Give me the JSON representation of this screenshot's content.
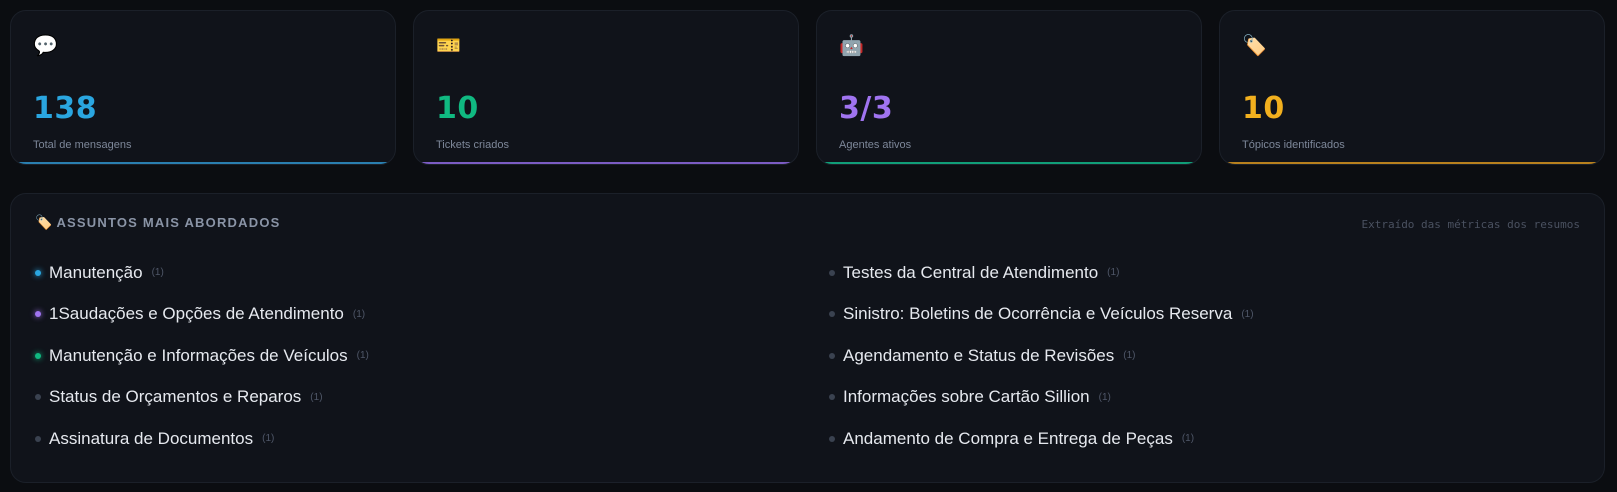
{
  "stats": [
    {
      "icon": "💬",
      "icon_name": "speech-bubble-icon",
      "value": "138",
      "label": "Total de mensagens",
      "color": "#2aa6e0",
      "accent": "#2a7fb0"
    },
    {
      "icon": "🎫",
      "icon_name": "ticket-icon",
      "value": "10",
      "label": "Tickets criados",
      "color": "#10b981",
      "accent": "#7c5cc4"
    },
    {
      "icon": "🤖",
      "icon_name": "robot-icon",
      "value": "3/3",
      "label": "Agentes ativos",
      "color": "#a074f0",
      "accent": "#119e78"
    },
    {
      "icon": "🏷️",
      "icon_name": "tag-icon",
      "value": "10",
      "label": "Tópicos identificados",
      "color": "#f2b01e",
      "accent": "#b8811e"
    }
  ],
  "topics": {
    "icon": "🏷️",
    "title": "ASSUNTOS MAIS ABORDADOS",
    "note": "Extraído das métricas dos resumos",
    "left": [
      {
        "label": "Manutenção",
        "count": "(1)",
        "dot": "#2aa6e0",
        "glow": true
      },
      {
        "label": "1Saudações e Opções de Atendimento",
        "count": "(1)",
        "dot": "#a074f0",
        "glow": true
      },
      {
        "label": "Manutenção e Informações de Veículos",
        "count": "(1)",
        "dot": "#10b981",
        "glow": true
      },
      {
        "label": "Status de Orçamentos e Reparos",
        "count": "(1)",
        "dot": "#3a4250",
        "glow": false
      },
      {
        "label": "Assinatura de Documentos",
        "count": "(1)",
        "dot": "#3a4250",
        "glow": false
      }
    ],
    "right": [
      {
        "label": "Testes da Central de Atendimento",
        "count": "(1)",
        "dot": "#3a4250",
        "glow": false
      },
      {
        "label": "Sinistro: Boletins de Ocorrência e Veículos Reserva",
        "count": "(1)",
        "dot": "#3a4250",
        "glow": false
      },
      {
        "label": "Agendamento e Status de Revisões",
        "count": "(1)",
        "dot": "#3a4250",
        "glow": false
      },
      {
        "label": "Informações sobre Cartão Sillion",
        "count": "(1)",
        "dot": "#3a4250",
        "glow": false
      },
      {
        "label": "Andamento de Compra e Entrega de Peças",
        "count": "(1)",
        "dot": "#3a4250",
        "glow": false
      }
    ]
  }
}
